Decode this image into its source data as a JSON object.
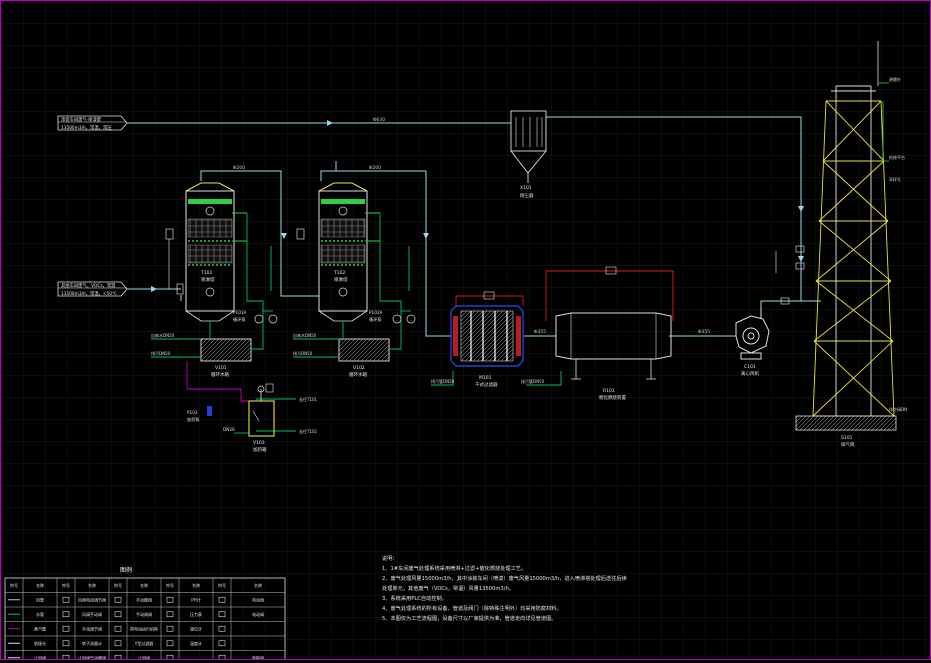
{
  "colors": {
    "background": "#000000",
    "grid": "#1d1d1d",
    "gas_pipe": "#9ad8e8",
    "water_pipe": "#00c060",
    "steam_pipe": "#d02020",
    "equipment": "#e0e0e0",
    "highlight_yellow": "#e8e040",
    "packing_green": "#30d040",
    "border": "#c000c0"
  },
  "inlets": {
    "top_label_1": "涂装车间废气·喷漆废",
    "top_label_2": "13500m3/h，常温，常压",
    "mid_label_1": "其他车间废气，VOCs，常温",
    "mid_label_2": "13500m3/h，常温，<50℃"
  },
  "pipe_sizes": {
    "main_top": "Φ630",
    "tower1_top": "Φ200",
    "tower2_top": "Φ200",
    "catalytic_in": "Φ355",
    "fan_in": "Φ355"
  },
  "equipment": {
    "t101": {
      "tag": "T101",
      "name": "喷淋塔"
    },
    "t102": {
      "tag": "T102",
      "name": "喷淋塔"
    },
    "v101": {
      "tag": "V101",
      "name": "循环水箱"
    },
    "v102": {
      "tag": "V102",
      "name": "循环水箱"
    },
    "v103": {
      "tag": "V103",
      "name": "加药箱"
    },
    "p101": {
      "tag": "P101A",
      "name": "循环泵"
    },
    "p102": {
      "tag": "P102A",
      "name": "循环泵"
    },
    "p103": {
      "tag": "P103",
      "name": "加药泵"
    },
    "x101": {
      "tag": "X101",
      "name": "除尘器"
    },
    "h101": {
      "tag": "M101",
      "name": "干式过滤器"
    },
    "r101": {
      "tag": "R101",
      "name": "催化燃烧装置"
    },
    "c101": {
      "tag": "C101",
      "name": "离心风机"
    },
    "s101": {
      "tag": "S101",
      "name": "排气筒"
    }
  },
  "line_labels": {
    "water_in_1": "自来水DN50",
    "drain_1": "排污DN50",
    "water_in_2": "自来水DN50",
    "drain_2": "排污DN50",
    "drain_h": "排污管DN50",
    "drain_r": "排污管DN50",
    "dosing_1": "去往T101",
    "dosing_2": "去往T102",
    "dn": "DN20",
    "stack_1": "避雷针",
    "stack_2": "检修平台",
    "stack_3": "采样孔",
    "stack_4": "排空阀DN"
  },
  "legend": {
    "title": "图例",
    "headers": [
      "符号",
      "名称",
      "符号",
      "名称",
      "符号",
      "名称",
      "符号",
      "名称",
      "符号",
      "名称"
    ],
    "rows": [
      [
        "",
        "风管",
        "",
        "风阀电动调节阀",
        "",
        "手动蝶阀",
        "",
        "PH计",
        "",
        "电动阀"
      ],
      [
        "",
        "水管",
        "",
        "风阀手动阀",
        "",
        "手动闸阀",
        "",
        "压力表",
        "",
        "电动阀"
      ],
      [
        "",
        "蒸汽管",
        "",
        "手动调节阀",
        "",
        "带电动执行机构",
        "",
        "液位计",
        "",
        ""
      ],
      [
        "",
        "软接头",
        "",
        "转子流量计",
        "",
        "Y型过滤器",
        "",
        "温度计",
        "",
        ""
      ],
      [
        "",
        "止回阀",
        "",
        "止回阀气动蝶阀",
        "",
        "止回阀",
        "",
        "",
        "",
        "电磁阀"
      ]
    ]
  },
  "notes": {
    "title": "说明：",
    "lines": [
      "1、1#车间废气处理系统采用喷淋+过滤+催化燃烧处理工艺。",
      "2、废气处理风量15000m3/h，其中涂装车间（喷漆）废气风量15000m3/h，进入喷淋塔处理后送往后续",
      "处理单元，其他废气（VOCs，常温）风量13500m3/h。",
      "3、系统采用PLC自动控制。",
      "4、废气处理系统的所有设备、管道及阀门（除特殊注明外）均采用防腐材料。",
      "5、本图仅为工艺流程图，设备尺寸以厂家提供为准，管道走向详见管道图。"
    ]
  }
}
